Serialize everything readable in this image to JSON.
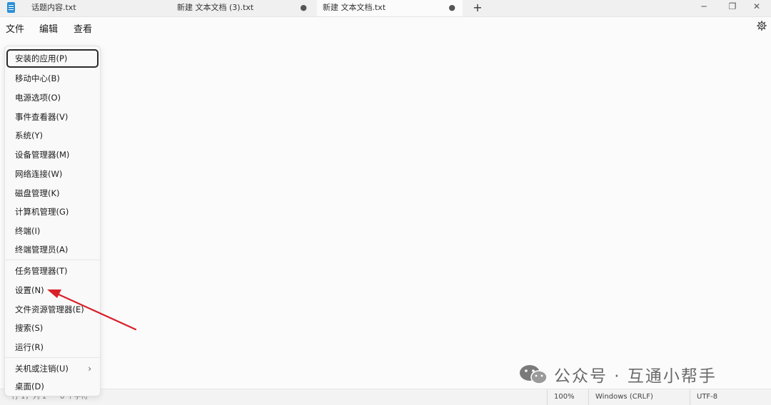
{
  "tabs": [
    {
      "label": "话题内容.txt",
      "modified": false
    },
    {
      "label": "新建 文本文档 (3).txt",
      "modified": true
    },
    {
      "label": "新建 文本文档.txt",
      "modified": true,
      "active": true
    }
  ],
  "tab_modified_glyph": "●",
  "new_tab_glyph": "+",
  "window_controls": {
    "minimize": "─",
    "maximize": "❐",
    "close": "✕"
  },
  "menu": {
    "file": "文件",
    "edit": "编辑",
    "view": "查看"
  },
  "context_menu": {
    "group1": [
      "安装的应用(P)",
      "移动中心(B)",
      "电源选项(O)",
      "事件查看器(V)",
      "系统(Y)",
      "设备管理器(M)",
      "网络连接(W)",
      "磁盘管理(K)",
      "计算机管理(G)",
      "终端(I)",
      "终端管理员(A)"
    ],
    "group2": [
      "任务管理器(T)",
      "设置(N)",
      "文件资源管理器(E)",
      "搜索(S)",
      "运行(R)"
    ],
    "group3": [
      "关机或注销(U)",
      "桌面(D)"
    ],
    "submenu_glyph": "›"
  },
  "status": {
    "position": "行 1，列 1",
    "chars": "0 个字符",
    "zoom": "100%",
    "line_ending": "Windows (CRLF)",
    "encoding": "UTF-8"
  },
  "watermark": {
    "text": "公众号 · 互通小帮手"
  },
  "colors": {
    "arrow": "#d9202a",
    "accent": "#2b8fd6"
  }
}
